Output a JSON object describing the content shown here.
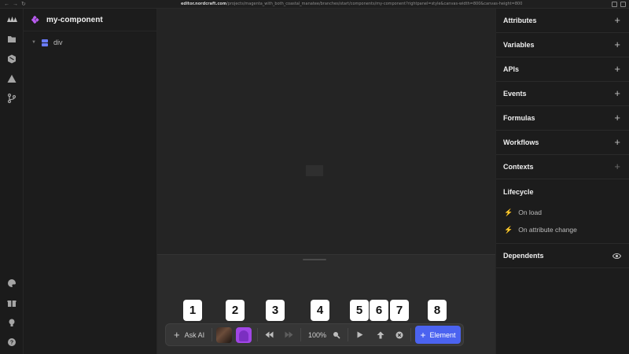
{
  "browser": {
    "url_host": "editor.nordcraft.com",
    "url_path": "/projects/magenta_with_both_coastal_manatee/branches/start/components/my-component?rightpanel=style&canvas-width=800&canvas-height=800"
  },
  "icons": {
    "rail_top": [
      "logo-icon",
      "folder-icon",
      "package-icon",
      "warning-icon",
      "git-branch-icon"
    ],
    "rail_bottom": [
      "palette-icon",
      "gift-icon",
      "lightbulb-icon",
      "help-icon"
    ]
  },
  "tree": {
    "component_name": "my-component",
    "nodes": [
      {
        "label": "div"
      }
    ]
  },
  "callouts": [
    "1",
    "2",
    "3",
    "4",
    "5",
    "6",
    "7",
    "8"
  ],
  "toolbar": {
    "ask_ai": "Ask AI",
    "zoom": "100%",
    "element": "Element"
  },
  "right_panel": {
    "sections": [
      "Attributes",
      "Variables",
      "APIs",
      "Events",
      "Formulas",
      "Workflows",
      "Contexts"
    ],
    "lifecycle": {
      "title": "Lifecycle",
      "items": [
        "On load",
        "On attribute change"
      ]
    },
    "dependents": "Dependents"
  },
  "colors": {
    "accent": "#4b63f0",
    "component_icon": "#b95cf0",
    "div_icon": "#6a7cff"
  }
}
